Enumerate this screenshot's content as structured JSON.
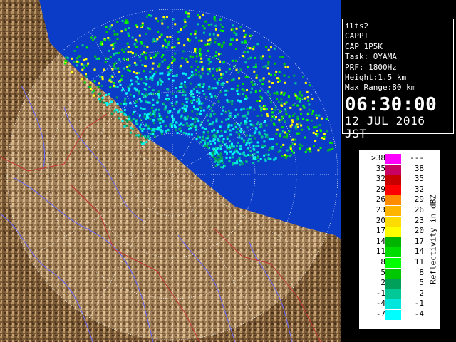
{
  "info": {
    "station": "ilts2",
    "product": "CAPPI",
    "product_id": "CAP_1P5K",
    "task": "Task: OYAMA",
    "prf": "PRF: 1800Hz",
    "height": "Height:1.5 km",
    "max_range": "Max Range:80 km",
    "time": "06:30:00",
    "date": "12 JUL 2016 JST"
  },
  "legend": {
    "unit_label": "Reflectivity in dBZ",
    "rows": [
      {
        "lo": ">38",
        "hi": "---",
        "color": "#ff00ff"
      },
      {
        "lo": "35",
        "hi": "38",
        "color": "#c80064"
      },
      {
        "lo": "32",
        "hi": "35",
        "color": "#c80000"
      },
      {
        "lo": "29",
        "hi": "32",
        "color": "#ff0000"
      },
      {
        "lo": "26",
        "hi": "29",
        "color": "#ff8c00"
      },
      {
        "lo": "23",
        "hi": "26",
        "color": "#ffb400"
      },
      {
        "lo": "20",
        "hi": "23",
        "color": "#ffdc00"
      },
      {
        "lo": "17",
        "hi": "20",
        "color": "#ffff00"
      },
      {
        "lo": "14",
        "hi": "17",
        "color": "#00b400"
      },
      {
        "lo": "11",
        "hi": "14",
        "color": "#00dc00"
      },
      {
        "lo": "8",
        "hi": "11",
        "color": "#00ff00"
      },
      {
        "lo": "5",
        "hi": "8",
        "color": "#00c800"
      },
      {
        "lo": "2",
        "hi": "5",
        "color": "#00a05a"
      },
      {
        "lo": "-1",
        "hi": "2",
        "color": "#00c896"
      },
      {
        "lo": "-4",
        "hi": "-1",
        "color": "#00e6dc"
      },
      {
        "lo": "-7",
        "hi": "-4",
        "color": "#00ffff"
      }
    ]
  },
  "colors": {
    "sea": "#0a3cc8",
    "land_dark": "#6e5030",
    "land_light": "#b48c5a",
    "range_ring": "#ffffff",
    "rivers": "#6a6aff",
    "borders": "#c83232"
  },
  "map": {
    "range_ring_km": [
      20,
      40,
      60,
      80
    ]
  }
}
